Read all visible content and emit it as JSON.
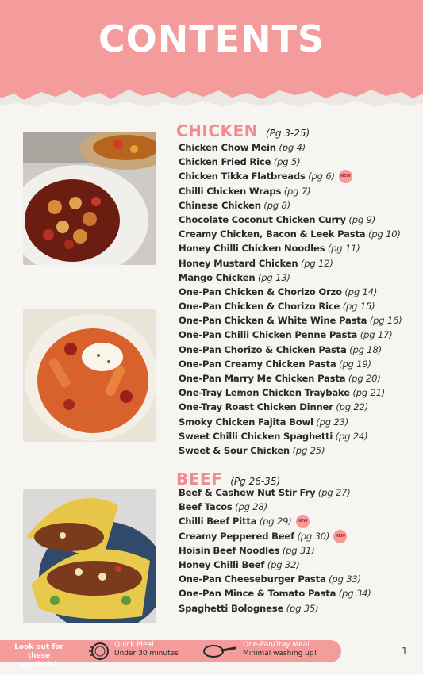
{
  "header": {
    "title": "CONTENTS"
  },
  "sections": [
    {
      "title": "CHICKEN",
      "pages": "(Pg 3-25)",
      "recipes": [
        {
          "name": "Chicken Chow Mein",
          "page": "(pg 4)"
        },
        {
          "name": "Chicken Fried Rice",
          "page": "(pg 5)"
        },
        {
          "name": "Chicken Tikka Flatbreads",
          "page": "(pg 6)",
          "badge": "NEW"
        },
        {
          "name": "Chilli Chicken Wraps",
          "page": "(pg 7)"
        },
        {
          "name": "Chinese Chicken",
          "page": "(pg 8)"
        },
        {
          "name": "Chocolate Coconut Chicken Curry",
          "page": "(pg 9)"
        },
        {
          "name": "Creamy Chicken, Bacon & Leek Pasta",
          "page": "(pg 10)"
        },
        {
          "name": "Honey Chilli Chicken Noodles",
          "page": "(pg 11)"
        },
        {
          "name": "Honey Mustard Chicken",
          "page": "(pg 12)"
        },
        {
          "name": "Mango Chicken",
          "page": "(pg 13)"
        },
        {
          "name": "One-Pan Chicken & Chorizo Orzo",
          "page": "(pg 14)"
        },
        {
          "name": "One-Pan Chicken & Chorizo Rice",
          "page": "(pg 15)"
        },
        {
          "name": "One-Pan Chicken & White Wine Pasta",
          "page": "(pg 16)"
        },
        {
          "name": "One-Pan Chilli Chicken Penne Pasta",
          "page": "(pg 17)"
        },
        {
          "name": "One-Pan Chorizo & Chicken Pasta",
          "page": "(pg 18)"
        },
        {
          "name": "One-Pan Creamy Chicken Pasta",
          "page": "(pg 19)"
        },
        {
          "name": "One-Pan Marry Me Chicken Pasta",
          "page": "(pg 20)"
        },
        {
          "name": "One-Tray Lemon Chicken Traybake",
          "page": "(pg 21)"
        },
        {
          "name": "One-Tray Roast Chicken Dinner",
          "page": "(pg 22)"
        },
        {
          "name": "Smoky Chicken Fajita Bowl",
          "page": "(pg 23)"
        },
        {
          "name": "Sweet Chilli Chicken Spaghetti",
          "page": "(pg 24)"
        },
        {
          "name": "Sweet & Sour Chicken",
          "page": "(pg 25)"
        }
      ]
    },
    {
      "title": "BEEF",
      "pages": "(Pg 26-35)",
      "recipes": [
        {
          "name": "Beef & Cashew Nut Stir Fry",
          "page": "(pg 27)"
        },
        {
          "name": "Beef Tacos",
          "page": "(pg 28)"
        },
        {
          "name": "Chilli Beef Pitta",
          "page": "(pg 29)",
          "badge": "NEW"
        },
        {
          "name": "Creamy Peppered Beef",
          "page": "(pg 30)",
          "badge": "NEW"
        },
        {
          "name": "Hoisin Beef Noodles",
          "page": "(pg 31)"
        },
        {
          "name": "Honey Chilli Beef",
          "page": "(pg 32)"
        },
        {
          "name": "One-Pan Cheeseburger Pasta",
          "page": "(pg 33)"
        },
        {
          "name": "One-Pan Mince & Tomato Pasta",
          "page": "(pg 34)"
        },
        {
          "name": "Spaghetti Bolognese",
          "page": "(pg 35)"
        }
      ]
    }
  ],
  "footer": {
    "look_out_line1": "Look out for",
    "look_out_line2": "these symbols!",
    "quick_title": "Quick Meal",
    "quick_desc": "Under 30 minutes",
    "onepan_title": "One-Pan/Tray Meal",
    "onepan_desc": "Minimal washing up!",
    "quick_icon": "timer-plate-icon",
    "onepan_icon": "frying-pan-icon"
  },
  "page_number": "1",
  "colors": {
    "accent": "#f49b9b",
    "section_title": "#f08c8c",
    "badge_text": "#b3262b"
  }
}
